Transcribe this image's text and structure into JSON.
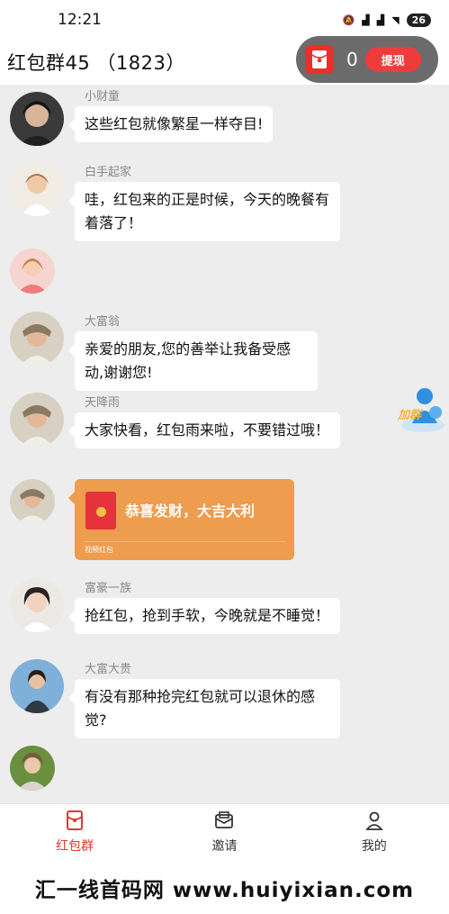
{
  "status": {
    "time": "12:21",
    "battery": "26"
  },
  "header": {
    "title": "红包群45 （1823）"
  },
  "wallet": {
    "count": "0",
    "withdraw_label": "提现"
  },
  "messages": [
    {
      "name": "小财童",
      "text": "这些红包就像繁星一样夺目!"
    },
    {
      "name": "白手起家",
      "text": "哇，红包来的正是时候，今天的晚餐有着落了！"
    },
    {
      "name": "",
      "text": ""
    },
    {
      "name": "大富翁",
      "text": "亲爱的朋友,您的善举让我备受感动,谢谢您!"
    },
    {
      "name": "天降雨",
      "text": "大家快看，红包雨来啦，不要错过哦！"
    },
    {
      "name": "",
      "text": ""
    },
    {
      "name": "富豪一族",
      "text": "抢红包，抢到手软，今晚就是不睡觉！"
    },
    {
      "name": "大富大贵",
      "text": "有没有那种抢完红包就可以退休的感觉?"
    }
  ],
  "red_packet": {
    "title": "恭喜发财，大吉大利",
    "footer": "视频红包"
  },
  "float_button": {
    "label": "加群"
  },
  "tabs": [
    {
      "label": "红包群",
      "icon": "red-packet-icon",
      "active": true
    },
    {
      "label": "邀请",
      "icon": "invite-icon",
      "active": false
    },
    {
      "label": "我的",
      "icon": "profile-icon",
      "active": false
    }
  ],
  "watermark": "汇一线首码网 www.huiyixian.com",
  "colors": {
    "accent": "#e03a30",
    "red_packet": "#ee9c4d",
    "chat_bg": "#ededed"
  }
}
